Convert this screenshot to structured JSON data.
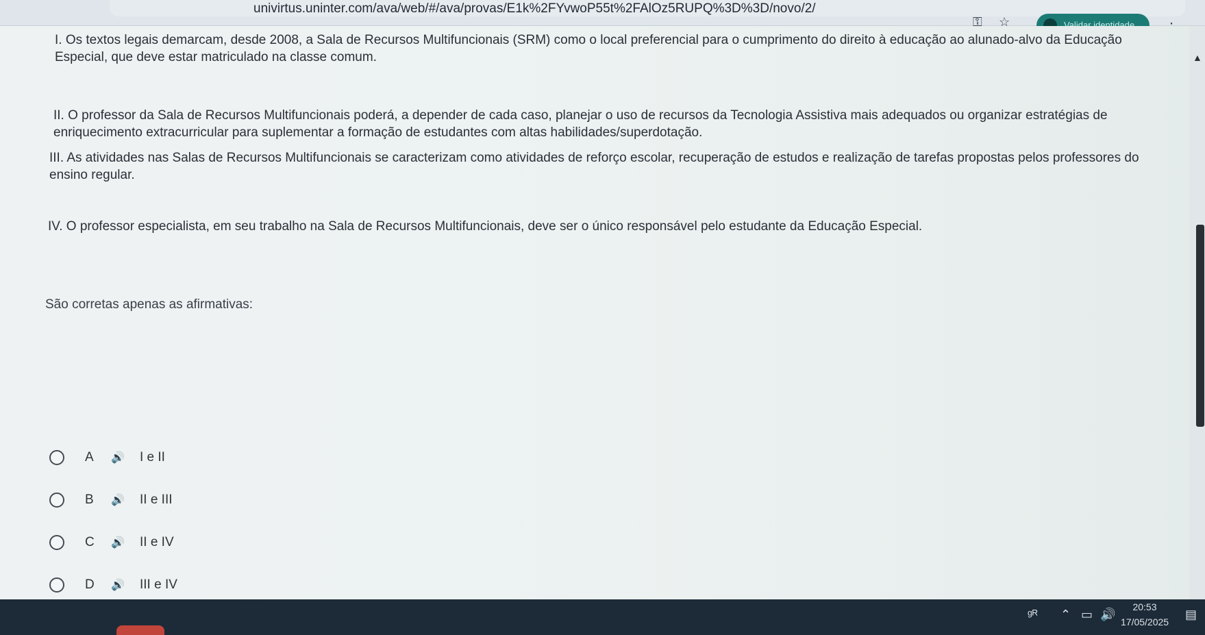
{
  "browser": {
    "url": "univirtus.uninter.com/ava/web/#/ava/provas/E1k%2FYvwoP55t%2FAlOz5RUPQ%3D%3D/novo/2/",
    "verify_label": "Validar identidade"
  },
  "question": {
    "statements": [
      "I. Os textos legais demarcam, desde 2008, a Sala de Recursos Multifuncionais (SRM) como o local preferencial para o cumprimento do direito à educação ao alunado-alvo da Educação Especial, que deve estar matriculado na classe comum.",
      "II. O professor da Sala de Recursos Multifuncionais poderá, a depender de cada caso, planejar o uso de recursos da Tecnologia Assistiva mais adequados ou organizar estratégias de enriquecimento extracurricular para suplementar a formação de estudantes com altas habilidades/superdotação.",
      "III. As atividades nas Salas de Recursos Multifuncionais se caracterizam como atividades de reforço escolar, recuperação de estudos e realização de tarefas propostas pelos professores do ensino regular.",
      "IV. O professor especialista, em seu trabalho na Sala de Recursos Multifuncionais, deve ser o único responsável pelo estudante da Educação Especial."
    ],
    "prompt": "São corretas apenas as afirmativas:",
    "options": [
      {
        "letter": "A",
        "text": "I e II"
      },
      {
        "letter": "B",
        "text": "II e III"
      },
      {
        "letter": "C",
        "text": "II e IV"
      },
      {
        "letter": "D",
        "text": "III e IV"
      }
    ],
    "speaker_icon": "speaker-icon"
  },
  "taskbar": {
    "time": "20:53",
    "date": "17/05/2025"
  },
  "colors": {
    "verify_button": "#1d7b76",
    "taskbar": "#1d2a37",
    "app_indicator": "#c2453b"
  }
}
